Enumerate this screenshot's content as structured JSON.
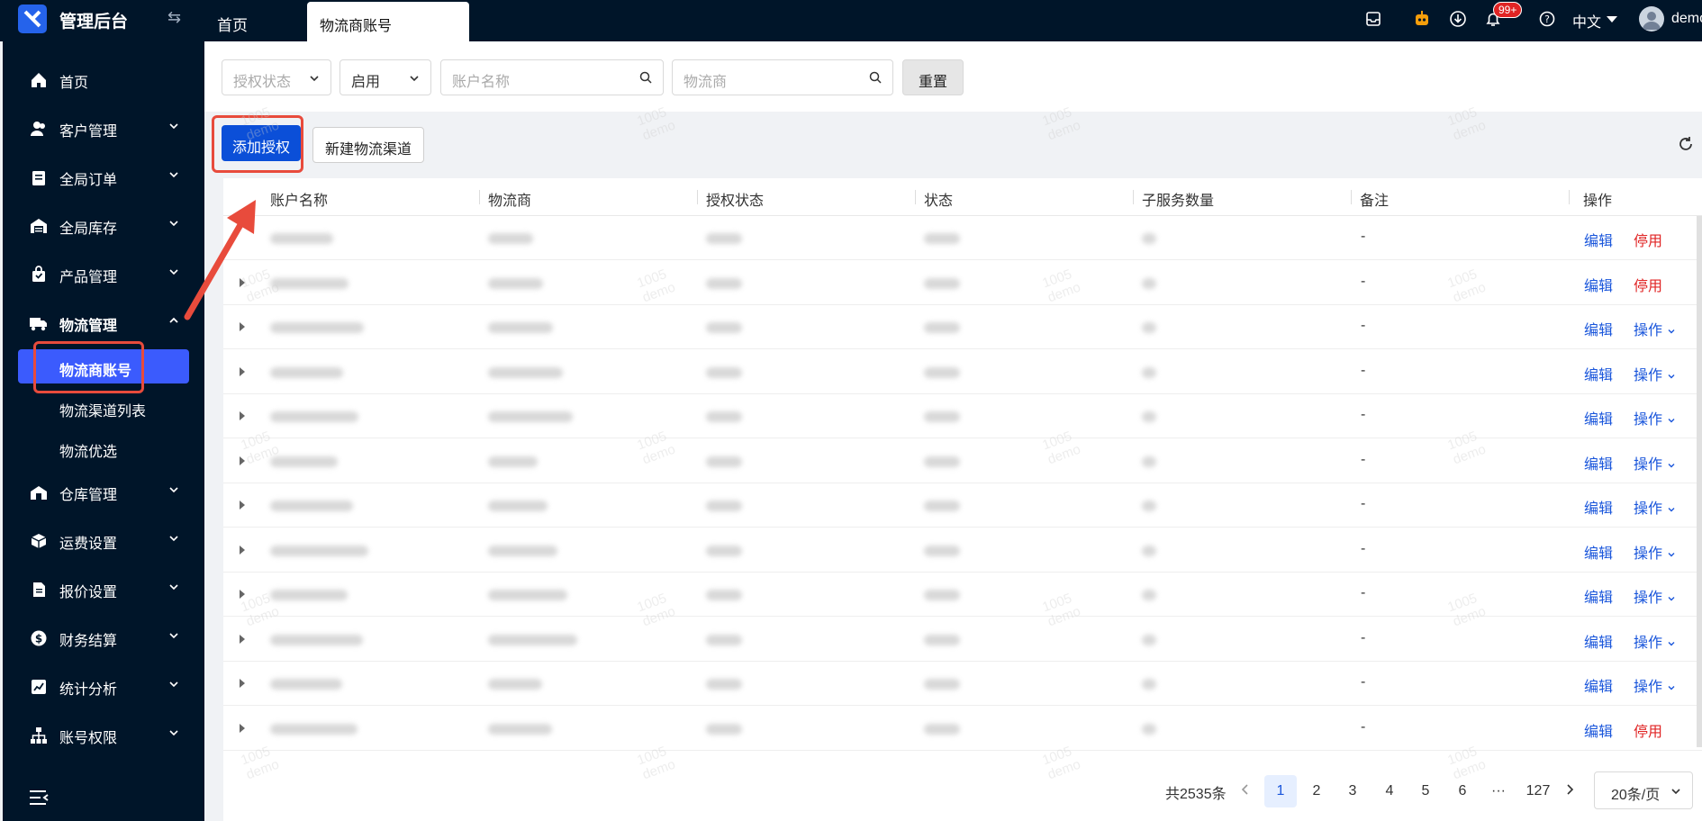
{
  "topbar": {
    "title": "管理后台",
    "tabs": [
      {
        "label": "首页"
      },
      {
        "label": "物流商账号"
      }
    ],
    "notification_badge": "99+",
    "language": "中文",
    "user": "demo"
  },
  "sidebar": {
    "items": [
      {
        "label": "首页",
        "icon": "home-icon"
      },
      {
        "label": "客户管理",
        "icon": "users-icon"
      },
      {
        "label": "全局订单",
        "icon": "clipboard-icon"
      },
      {
        "label": "全局库存",
        "icon": "warehouse-icon"
      },
      {
        "label": "产品管理",
        "icon": "bag-icon"
      },
      {
        "label": "物流管理",
        "icon": "truck-icon"
      },
      {
        "label": "仓库管理",
        "icon": "building-icon"
      },
      {
        "label": "运费设置",
        "icon": "box-icon"
      },
      {
        "label": "报价设置",
        "icon": "document-icon"
      },
      {
        "label": "财务结算",
        "icon": "dollar-icon"
      },
      {
        "label": "统计分析",
        "icon": "chart-icon"
      },
      {
        "label": "账号权限",
        "icon": "org-icon"
      }
    ],
    "logistics_children": [
      {
        "label": "物流商账号"
      },
      {
        "label": "物流渠道列表"
      },
      {
        "label": "物流优选"
      }
    ]
  },
  "filters": {
    "auth_status_placeholder": "授权状态",
    "status_value": "启用",
    "account_placeholder": "账户名称",
    "carrier_placeholder": "物流商",
    "reset_label": "重置"
  },
  "toolbar": {
    "add_auth_label": "添加授权",
    "new_channel_label": "新建物流渠道"
  },
  "table": {
    "columns": [
      "账户名称",
      "物流商",
      "授权状态",
      "状态",
      "子服务数量",
      "备注",
      "操作"
    ],
    "rows": [
      {
        "remark": "-",
        "edit": "编辑",
        "action": "停用",
        "type": "stop"
      },
      {
        "remark": "-",
        "edit": "编辑",
        "action": "停用",
        "type": "stop"
      },
      {
        "remark": "-",
        "edit": "编辑",
        "action": "操作",
        "type": "more"
      },
      {
        "remark": "-",
        "edit": "编辑",
        "action": "操作",
        "type": "more"
      },
      {
        "remark": "-",
        "edit": "编辑",
        "action": "操作",
        "type": "more"
      },
      {
        "remark": "-",
        "edit": "编辑",
        "action": "操作",
        "type": "more"
      },
      {
        "remark": "-",
        "edit": "编辑",
        "action": "操作",
        "type": "more"
      },
      {
        "remark": "-",
        "edit": "编辑",
        "action": "操作",
        "type": "more"
      },
      {
        "remark": "-",
        "edit": "编辑",
        "action": "操作",
        "type": "more"
      },
      {
        "remark": "-",
        "edit": "编辑",
        "action": "操作",
        "type": "more"
      },
      {
        "remark": "-",
        "edit": "编辑",
        "action": "操作",
        "type": "more"
      },
      {
        "remark": "-",
        "edit": "编辑",
        "action": "停用",
        "type": "stop"
      }
    ]
  },
  "pagination": {
    "total": "共2535条",
    "pages": [
      "1",
      "2",
      "3",
      "4",
      "5",
      "6"
    ],
    "ellipsis": "···",
    "last": "127",
    "page_size": "20条/页"
  },
  "watermark": {
    "line1": "1005",
    "line2": "demo"
  },
  "colors": {
    "primary": "#0b4fd8",
    "danger": "#e02424",
    "link": "#1a56db",
    "nav_bg": "#001529",
    "highlight": "#e84b3c"
  }
}
